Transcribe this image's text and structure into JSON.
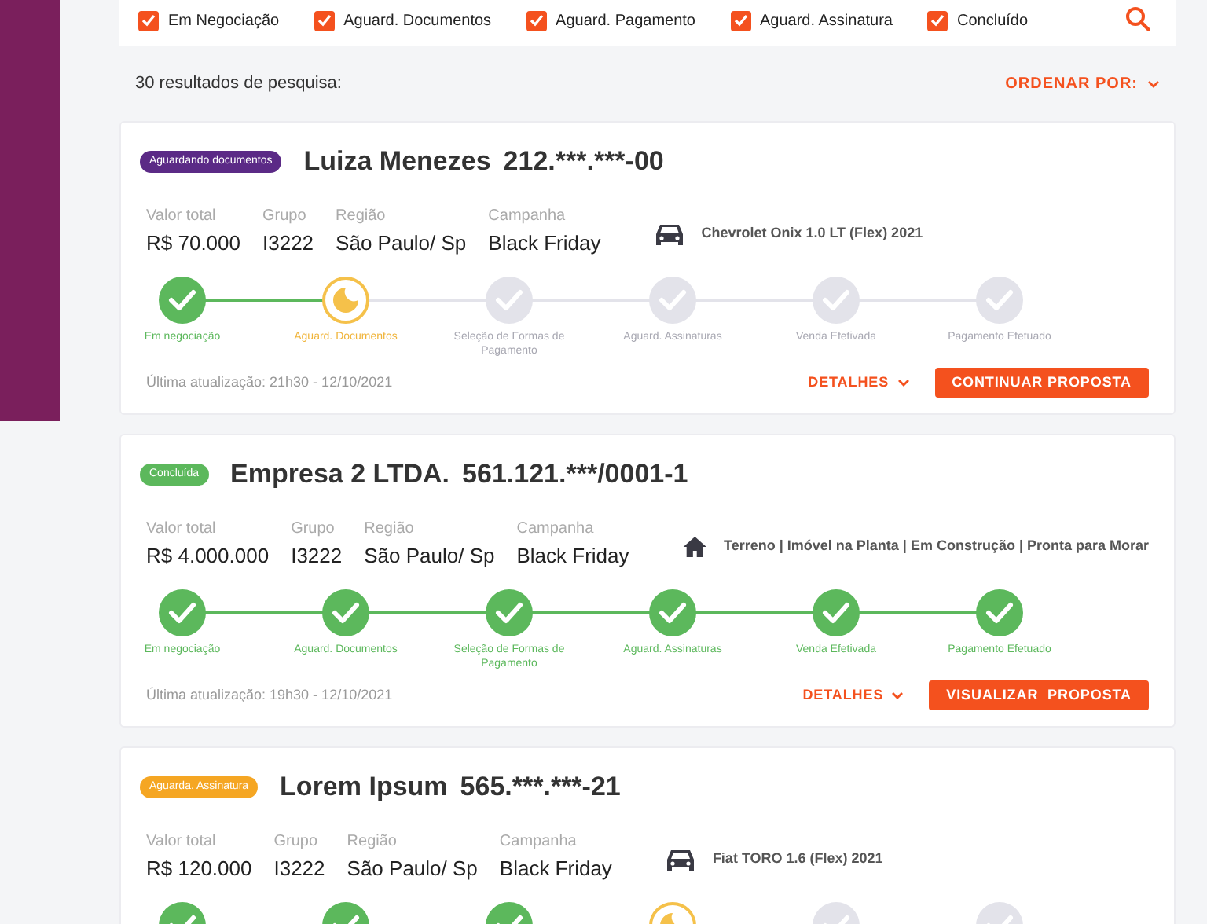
{
  "filters": [
    {
      "label": "Em Negociação",
      "checked": true
    },
    {
      "label": "Aguard. Documentos",
      "checked": true
    },
    {
      "label": "Aguard. Pagamento",
      "checked": true
    },
    {
      "label": "Aguard. Assinatura",
      "checked": true
    },
    {
      "label": "Concluído",
      "checked": true
    }
  ],
  "results_count": "30 resultados de pesquisa:",
  "sort_label": "ORDENAR POR:",
  "proposals": [
    {
      "status": {
        "label": "Aguardando documentos",
        "color": "#5b2a86"
      },
      "name": "Luiza Menezes",
      "document": "212.***.***-00",
      "fields": [
        {
          "label": "Valor total",
          "value": "R$ 70.000"
        },
        {
          "label": "Grupo",
          "value": "I3222"
        },
        {
          "label": "Região",
          "value": "São Paulo/ Sp"
        },
        {
          "label": "Campanha",
          "value": "Black Friday"
        }
      ],
      "asset": {
        "kind": "car",
        "text": "Chevrolet Onix 1.0 LT (Flex) 2021"
      },
      "steps": [
        {
          "label": "Em negociação",
          "completed": true,
          "in_progress": false
        },
        {
          "label": "Aguard. Documentos",
          "completed": false,
          "in_progress": true
        },
        {
          "label": "Seleção de Formas de Pagamento",
          "completed": false,
          "in_progress": false
        },
        {
          "label": "Aguard. Assinaturas",
          "completed": false,
          "in_progress": false
        },
        {
          "label": "Venda Efetivada",
          "completed": false,
          "in_progress": false
        },
        {
          "label": "Pagamento Efetuado",
          "completed": false,
          "in_progress": false
        }
      ],
      "last_update": "Última atualização: 21h30 - 12/10/2021",
      "details_label": "DETALHES",
      "action_label": "CONTINUAR PROPOSTA"
    },
    {
      "status": {
        "label": "Concluída",
        "color": "#5cb85c"
      },
      "name": "Empresa 2 LTDA.",
      "document": "561.121.***/0001-1",
      "fields": [
        {
          "label": "Valor total",
          "value": "R$ 4.000.000"
        },
        {
          "label": "Grupo",
          "value": "I3222"
        },
        {
          "label": "Região",
          "value": "São Paulo/ Sp"
        },
        {
          "label": "Campanha",
          "value": "Black Friday"
        }
      ],
      "asset": {
        "kind": "house",
        "text": "Terreno | Imóvel na Planta | Em Construção | Pronta para Morar"
      },
      "steps": [
        {
          "label": "Em negociação",
          "completed": true,
          "in_progress": false
        },
        {
          "label": "Aguard. Documentos",
          "completed": true,
          "in_progress": false
        },
        {
          "label": "Seleção de Formas de Pagamento",
          "completed": true,
          "in_progress": false
        },
        {
          "label": "Aguard. Assinaturas",
          "completed": true,
          "in_progress": false
        },
        {
          "label": "Venda Efetivada",
          "completed": true,
          "in_progress": false
        },
        {
          "label": "Pagamento Efetuado",
          "completed": true,
          "in_progress": false
        }
      ],
      "last_update": "Última atualização: 19h30 - 12/10/2021",
      "details_label": "DETALHES",
      "action_label": "VISUALIZAR  PROPOSTA"
    },
    {
      "status": {
        "label": "Aguarda. Assinatura",
        "color": "#f5a623"
      },
      "name": "Lorem Ipsum",
      "document": "565.***.***-21",
      "fields": [
        {
          "label": "Valor total",
          "value": "R$ 120.000"
        },
        {
          "label": "Grupo",
          "value": "I3222"
        },
        {
          "label": "Região",
          "value": "São Paulo/ Sp"
        },
        {
          "label": "Campanha",
          "value": "Black Friday"
        }
      ],
      "asset": {
        "kind": "car",
        "text": "Fiat TORO 1.6 (Flex) 2021"
      },
      "steps": [
        {
          "completed": true,
          "in_progress": false
        },
        {
          "completed": true,
          "in_progress": false
        },
        {
          "completed": true,
          "in_progress": false
        },
        {
          "completed": false,
          "in_progress": true
        },
        {
          "completed": false,
          "in_progress": false
        },
        {
          "completed": false,
          "in_progress": false
        }
      ]
    }
  ]
}
